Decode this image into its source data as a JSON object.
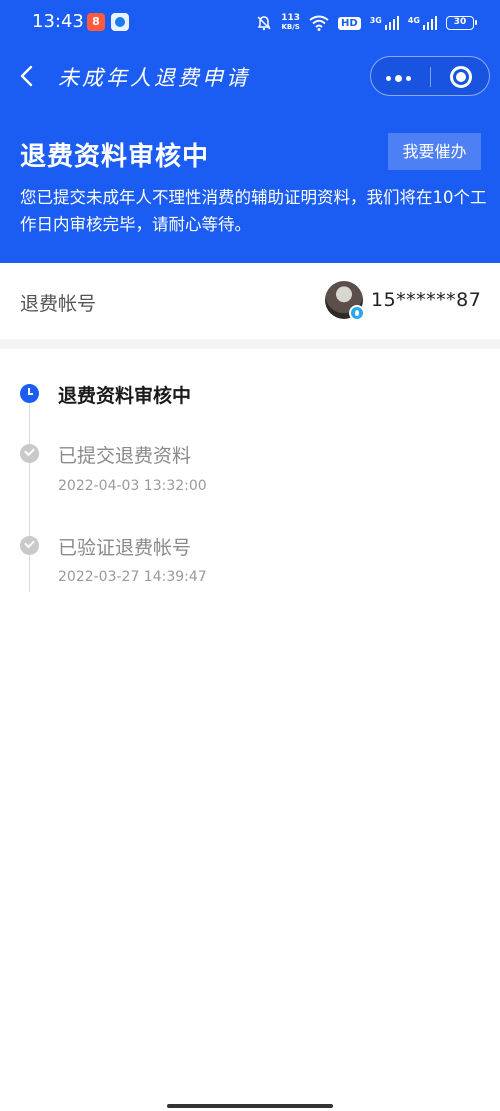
{
  "status_bar": {
    "time": "13:43",
    "app1_icon": "app-badge-icon",
    "app2_icon": "app-circle-icon",
    "net_speed_value": "113",
    "net_speed_unit": "KB/S",
    "hd_label": "HD",
    "net_label_1": "3G",
    "net_label_2": "4G",
    "battery": "30"
  },
  "nav": {
    "title": "未成年人退费申请"
  },
  "hero": {
    "title": "退费资料审核中",
    "urge_button": "我要催办",
    "description": "您已提交未成年人不理性消费的辅助证明资料，我们将在10个工作日内审核完毕，请耐心等待。"
  },
  "account": {
    "label": "退费帐号",
    "number": "15******87"
  },
  "timeline": [
    {
      "title": "退费资料审核中",
      "time": "",
      "state": "current"
    },
    {
      "title": "已提交退费资料",
      "time": "2022-04-03 13:32:00",
      "state": "done"
    },
    {
      "title": "已验证退费帐号",
      "time": "2022-03-27 14:39:47",
      "state": "done"
    }
  ],
  "colors": {
    "primary": "#1b5cf2",
    "done_gray": "#c9c9c9"
  }
}
